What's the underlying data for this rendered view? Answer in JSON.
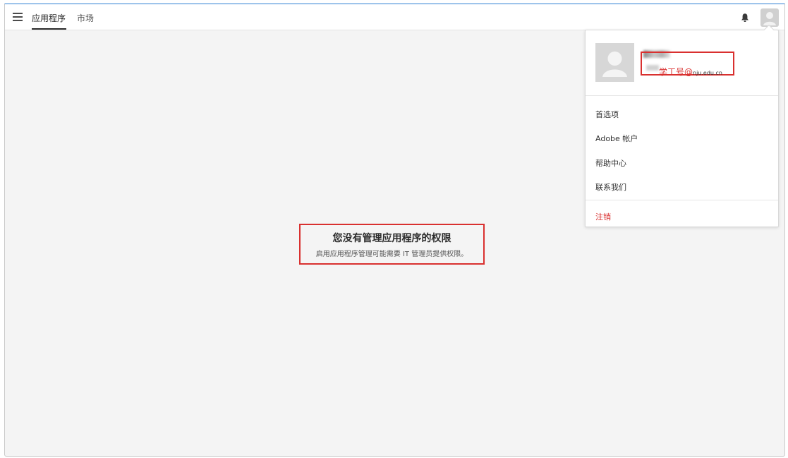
{
  "topbar": {
    "menu_icon": "hamburger-icon",
    "tabs": [
      {
        "label": "应用程序",
        "active": true
      },
      {
        "label": "市场",
        "active": false
      }
    ],
    "bell_icon": "bell-icon",
    "avatar_icon": "user-avatar-icon"
  },
  "main": {
    "title": "您没有管理应用程序的权限",
    "subtitle": "启用应用程序管理可能需要 IT 管理员提供权限。"
  },
  "profile_menu": {
    "email_id": "学工号@",
    "email_domain": "nju.edu.cn",
    "items": [
      {
        "label": "首选项"
      },
      {
        "label": "Adobe 帐户"
      },
      {
        "label": "帮助中心"
      },
      {
        "label": "联系我们"
      }
    ],
    "sign_out": "注销"
  },
  "colors": {
    "accent_red": "#d9302f",
    "background": "#f4f4f4",
    "topbar_accent": "#2d7fd3"
  }
}
